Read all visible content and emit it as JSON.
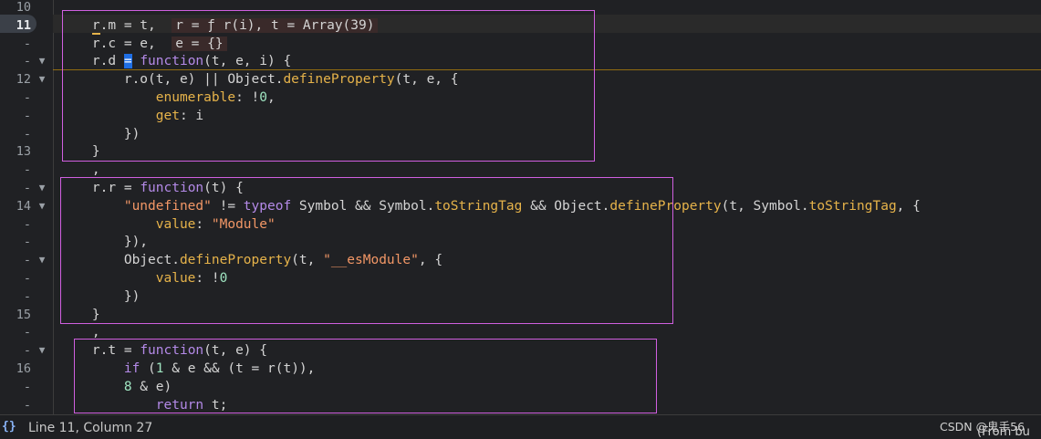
{
  "editor": {
    "lines": [
      {
        "ln": "10",
        "fold": "",
        "tokens": []
      },
      {
        "ln": "11",
        "fold": "",
        "tokens": [
          {
            "t": "    ",
            "c": ""
          },
          {
            "t": "r",
            "c": "var caret-under"
          },
          {
            "t": ".m = t,  ",
            "c": "op"
          },
          {
            "t": "r = ƒ r(i), t = Array(39)",
            "c": "inline-val"
          }
        ]
      },
      {
        "ln": "-",
        "fold": "",
        "tokens": [
          {
            "t": "    r.c = e,  ",
            "c": "op"
          },
          {
            "t": "e = {}",
            "c": "inline-val"
          }
        ]
      },
      {
        "ln": "-",
        "fold": "▼",
        "tokens": [
          {
            "t": "    r.d ",
            "c": "op"
          },
          {
            "t": "=",
            "c": "cursor-mark"
          },
          {
            "t": " ",
            "c": "op"
          },
          {
            "t": "function",
            "c": "kw"
          },
          {
            "t": "(t, e, i) {",
            "c": "op"
          }
        ]
      },
      {
        "ln": "12",
        "fold": "▼",
        "tokens": [
          {
            "t": "        r.o(t, e) || Object.",
            "c": "op"
          },
          {
            "t": "defineProperty",
            "c": "fn"
          },
          {
            "t": "(t, e, {",
            "c": "op"
          }
        ]
      },
      {
        "ln": "-",
        "fold": "",
        "tokens": [
          {
            "t": "            ",
            "c": ""
          },
          {
            "t": "enumerable",
            "c": "key"
          },
          {
            "t": ": !",
            "c": "op"
          },
          {
            "t": "0",
            "c": "num"
          },
          {
            "t": ",",
            "c": "op"
          }
        ]
      },
      {
        "ln": "-",
        "fold": "",
        "tokens": [
          {
            "t": "            ",
            "c": ""
          },
          {
            "t": "get",
            "c": "key"
          },
          {
            "t": ": i",
            "c": "op"
          }
        ]
      },
      {
        "ln": "-",
        "fold": "",
        "tokens": [
          {
            "t": "        })",
            "c": "op"
          }
        ]
      },
      {
        "ln": "13",
        "fold": "",
        "tokens": [
          {
            "t": "    }",
            "c": "op"
          }
        ]
      },
      {
        "ln": "-",
        "fold": "",
        "tokens": [
          {
            "t": "    ,",
            "c": "op"
          }
        ]
      },
      {
        "ln": "-",
        "fold": "▼",
        "tokens": [
          {
            "t": "    r.r = ",
            "c": "op"
          },
          {
            "t": "function",
            "c": "kw"
          },
          {
            "t": "(t) {",
            "c": "op"
          }
        ]
      },
      {
        "ln": "14",
        "fold": "▼",
        "tokens": [
          {
            "t": "        ",
            "c": ""
          },
          {
            "t": "\"undefined\"",
            "c": "str"
          },
          {
            "t": " != ",
            "c": "op"
          },
          {
            "t": "typeof",
            "c": "kw"
          },
          {
            "t": " Symbol && Symbol.",
            "c": "op"
          },
          {
            "t": "toStringTag",
            "c": "fn"
          },
          {
            "t": " && Object.",
            "c": "op"
          },
          {
            "t": "defineProperty",
            "c": "fn"
          },
          {
            "t": "(t, Symbol.",
            "c": "op"
          },
          {
            "t": "toStringTag",
            "c": "fn"
          },
          {
            "t": ", {",
            "c": "op"
          }
        ]
      },
      {
        "ln": "-",
        "fold": "",
        "tokens": [
          {
            "t": "            ",
            "c": ""
          },
          {
            "t": "value",
            "c": "key"
          },
          {
            "t": ": ",
            "c": "op"
          },
          {
            "t": "\"Module\"",
            "c": "str"
          }
        ]
      },
      {
        "ln": "-",
        "fold": "",
        "tokens": [
          {
            "t": "        }),",
            "c": "op"
          }
        ]
      },
      {
        "ln": "-",
        "fold": "▼",
        "tokens": [
          {
            "t": "        Object.",
            "c": "op"
          },
          {
            "t": "defineProperty",
            "c": "fn"
          },
          {
            "t": "(t, ",
            "c": "op"
          },
          {
            "t": "\"__esModule\"",
            "c": "str"
          },
          {
            "t": ", {",
            "c": "op"
          }
        ]
      },
      {
        "ln": "-",
        "fold": "",
        "tokens": [
          {
            "t": "            ",
            "c": ""
          },
          {
            "t": "value",
            "c": "key"
          },
          {
            "t": ": !",
            "c": "op"
          },
          {
            "t": "0",
            "c": "num"
          }
        ]
      },
      {
        "ln": "-",
        "fold": "",
        "tokens": [
          {
            "t": "        })",
            "c": "op"
          }
        ]
      },
      {
        "ln": "15",
        "fold": "",
        "tokens": [
          {
            "t": "    }",
            "c": "op"
          }
        ]
      },
      {
        "ln": "-",
        "fold": "",
        "tokens": [
          {
            "t": "    ,",
            "c": "op"
          }
        ]
      },
      {
        "ln": "-",
        "fold": "▼",
        "tokens": [
          {
            "t": "    r.t = ",
            "c": "op"
          },
          {
            "t": "function",
            "c": "kw"
          },
          {
            "t": "(t, e) {",
            "c": "op"
          }
        ]
      },
      {
        "ln": "16",
        "fold": "",
        "tokens": [
          {
            "t": "        ",
            "c": ""
          },
          {
            "t": "if",
            "c": "kw"
          },
          {
            "t": " (",
            "c": "op"
          },
          {
            "t": "1",
            "c": "num"
          },
          {
            "t": " & e && (t = r(t)),",
            "c": "op"
          }
        ]
      },
      {
        "ln": "-",
        "fold": "",
        "tokens": [
          {
            "t": "        ",
            "c": ""
          },
          {
            "t": "8",
            "c": "num"
          },
          {
            "t": " & e)",
            "c": "op"
          }
        ]
      },
      {
        "ln": "-",
        "fold": "",
        "tokens": [
          {
            "t": "            ",
            "c": ""
          },
          {
            "t": "return",
            "c": "kw"
          },
          {
            "t": " t;",
            "c": "op"
          }
        ]
      }
    ],
    "current_line": "11"
  },
  "status": {
    "braces": "{}",
    "position": "Line 11, Column 27",
    "watermark": "CSDN @鬼手56",
    "source": "(From bu"
  },
  "colors": {
    "highlight_box": "#d05fe0",
    "keyword": "#b48ae8",
    "function": "#e6b34a",
    "string": "#f29766"
  }
}
